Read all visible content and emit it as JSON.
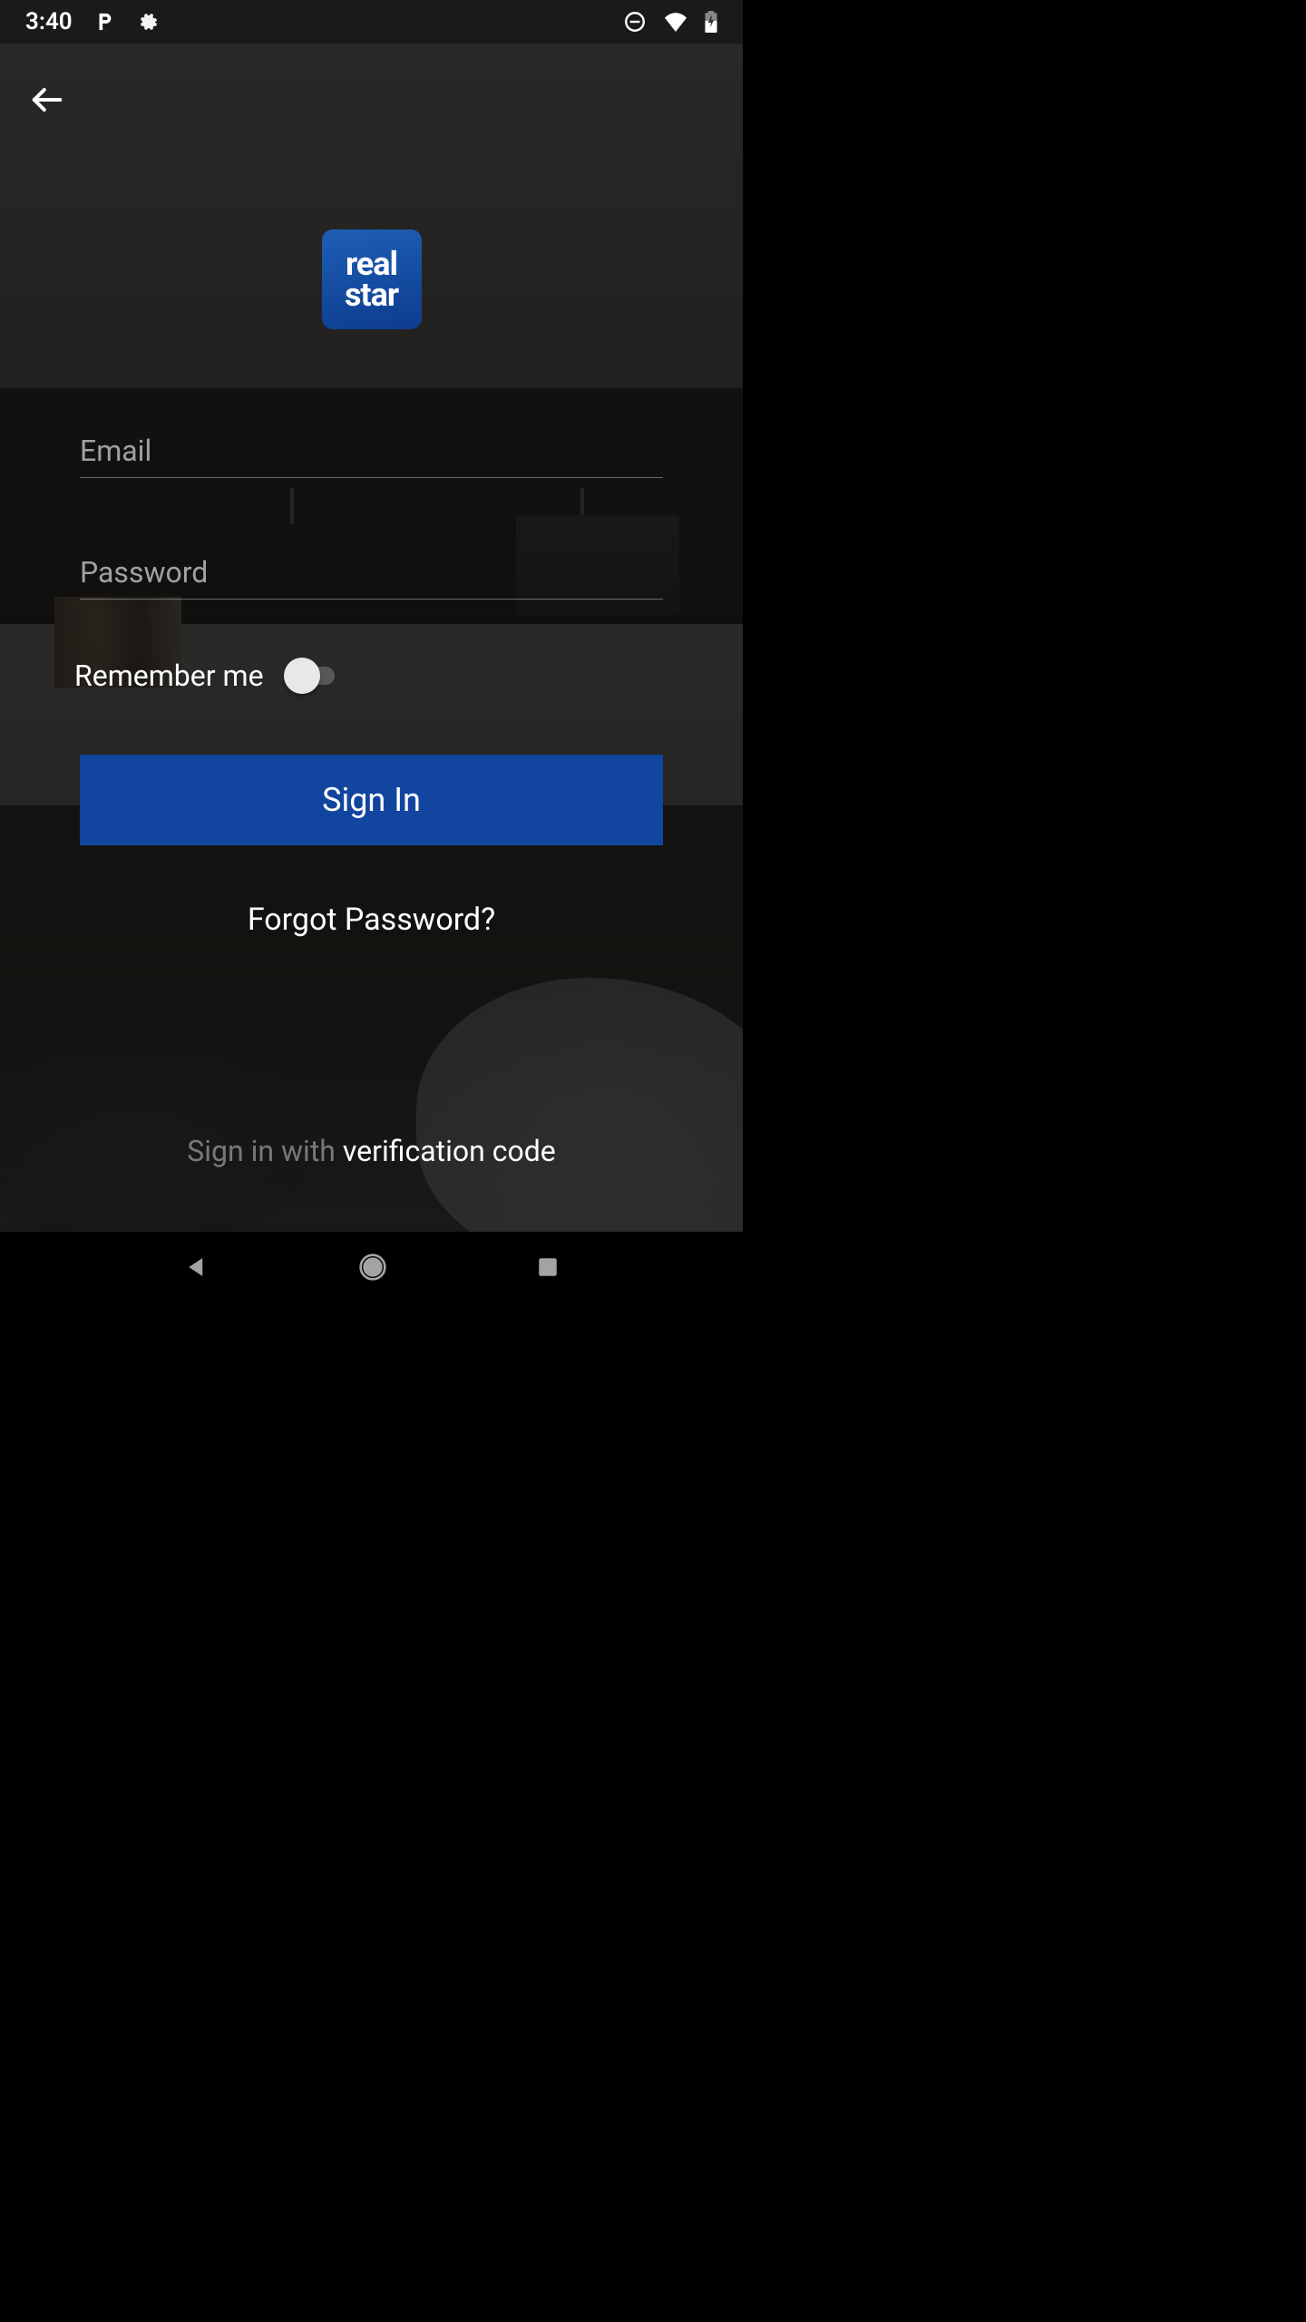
{
  "status_bar": {
    "time": "3:40",
    "icons_left": [
      "p-icon",
      "gear-broken-icon"
    ],
    "icons_right": [
      "do-not-disturb-icon",
      "wifi-icon",
      "battery-charging-icon"
    ]
  },
  "logo": {
    "line1": "real",
    "line2": "star"
  },
  "form": {
    "email_placeholder": "Email",
    "email_value": "",
    "password_placeholder": "Password",
    "password_value": "",
    "remember_label": "Remember me",
    "remember_checked": false,
    "submit_label": "Sign In",
    "forgot_label": "Forgot Password?"
  },
  "alt_signin": {
    "prefix": "Sign in with ",
    "emphasis": "verification code"
  },
  "colors": {
    "brand_blue": "#12459f",
    "logo_blue_top": "#1e5fb5",
    "logo_blue_bottom": "#0d3c8f"
  }
}
